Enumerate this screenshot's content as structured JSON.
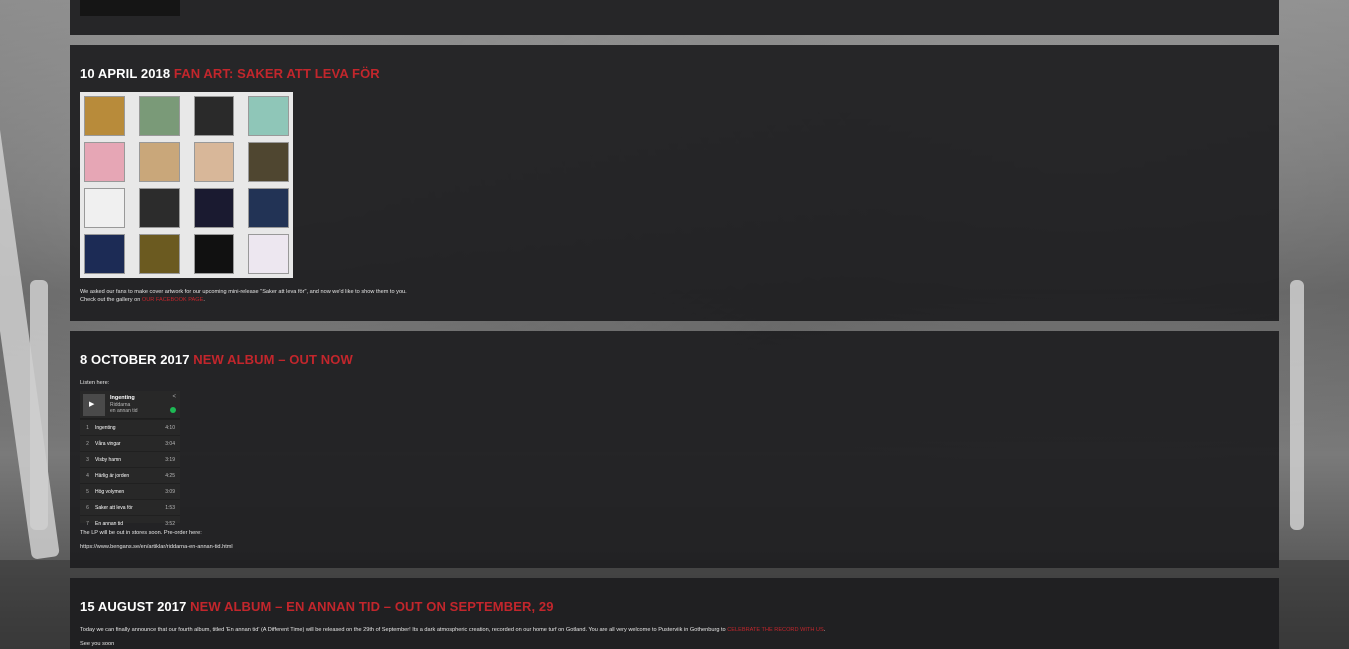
{
  "colors": {
    "accent": "#c2262c",
    "card_bg": "#1e1e20",
    "text": "#e8e8e8"
  },
  "posts": [
    {
      "date": "10 APRIL 2018",
      "title": "FAN ART: SAKER ATT LEVA FÖR",
      "text": "We asked our fans to make cover artwork for our upcoming mini-release \"Saker att leva för\", and now we'd like to show them to you.",
      "text2_prefix": "Check out the gallery on ",
      "link": "OUR FACEBOOK PAGE",
      "text2_suffix": "."
    },
    {
      "date": "8 OCTOBER 2017",
      "title": "NEW ALBUM – OUT NOW",
      "listen": "Listen here:",
      "after": "The LP will be out in stores soon. Pre-order here:",
      "url": "https://www.bengans.se/en/artiklar/riddarna-en-annan-tid.html"
    },
    {
      "date": "15 AUGUST 2017",
      "title": "NEW ALBUM – EN ANNAN TID – OUT ON SEPTEMBER, 29",
      "text": "Today we can finally announce that our fourth album, titled 'En annan tid' (A Different Time) will be released on the 29th of September! Its a dark atmospheric creation, recorded on our home turf on Gotland. You are all very welcome to Pusterviik in Gothenburg to ",
      "link": "CELEBRATE THE RECORD WITH US",
      "text_suffix": ".",
      "text2": "See you soon"
    }
  ],
  "player": {
    "track": "Ingenting",
    "artist": "Riddarna",
    "album": "en annan tid",
    "share_icon": "share-icon",
    "play_icon": "play-icon",
    "tracks": [
      {
        "n": "1",
        "name": "Ingenting",
        "dur": "4:10"
      },
      {
        "n": "2",
        "name": "Våra vingar",
        "dur": "3:04"
      },
      {
        "n": "3",
        "name": "Visby hamn",
        "dur": "3:19"
      },
      {
        "n": "4",
        "name": "Härlig är jorden",
        "dur": "4:25"
      },
      {
        "n": "5",
        "name": "Hög volymen",
        "dur": "3:09"
      },
      {
        "n": "6",
        "name": "Saker att leva för",
        "dur": "1:53"
      },
      {
        "n": "7",
        "name": "En annan tid",
        "dur": "3:52"
      }
    ]
  },
  "gallery_tile_colors": [
    "#b88b3a",
    "#7a9a78",
    "#2a2a2a",
    "#8fc6b8",
    "#e6a6b5",
    "#c9a77a",
    "#d8b799",
    "#4f4630",
    "#f0f0f0",
    "#2c2c2c",
    "#1a1a30",
    "#223355",
    "#1c2b55",
    "#6b5a20",
    "#111111",
    "#ede7f0"
  ]
}
